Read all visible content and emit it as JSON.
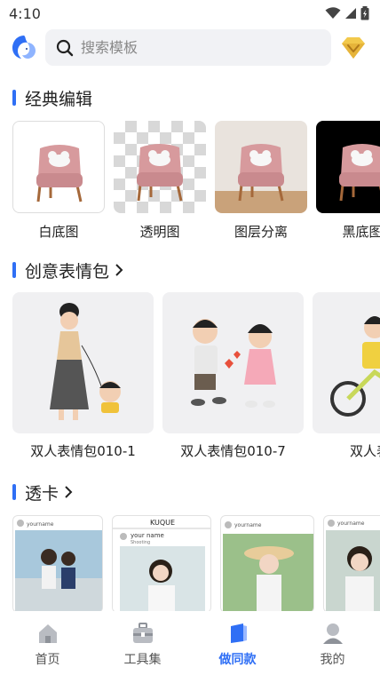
{
  "status": {
    "time": "4:10"
  },
  "search": {
    "placeholder": "搜索模板"
  },
  "sections": {
    "classic": {
      "title": "经典编辑",
      "items": [
        {
          "label": "白底图"
        },
        {
          "label": "透明图"
        },
        {
          "label": "图层分离"
        },
        {
          "label": "黑底图"
        }
      ]
    },
    "sticker": {
      "title": "创意表情包",
      "items": [
        {
          "label": "双人表情包010-1"
        },
        {
          "label": "双人表情包010-7"
        },
        {
          "label": "双人表情包"
        }
      ]
    },
    "transparent_card": {
      "title": "透卡",
      "items": [
        {
          "username": "yourname"
        },
        {
          "header": "KUQUE",
          "username": "your name",
          "sub": "Shooting"
        },
        {
          "username": "yourname"
        },
        {
          "username": "yourname"
        }
      ]
    }
  },
  "nav": {
    "items": [
      {
        "label": "首页",
        "icon": "home-icon"
      },
      {
        "label": "工具集",
        "icon": "toolbox-icon"
      },
      {
        "label": "做同款",
        "icon": "template-icon",
        "active": true
      },
      {
        "label": "我的",
        "icon": "profile-icon"
      }
    ]
  },
  "colors": {
    "accent": "#2f6ff5",
    "vip": "#f2c94c"
  }
}
